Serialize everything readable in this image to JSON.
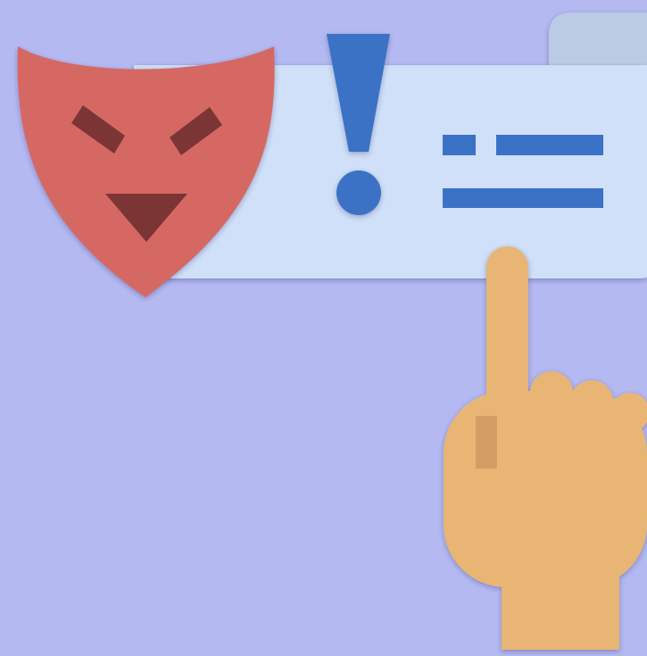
{
  "colors": {
    "background": "#B4B9F1",
    "panel": "#CFE0F8",
    "panel_tab": "#BACBE3",
    "alert_accent": "#3A72C6",
    "mask": "#D66764",
    "mask_features": "#7B3534",
    "hand": "#E8B575",
    "hand_shade": "#D39E63"
  },
  "icons": {
    "mask": "devil-mask-icon",
    "alert": "exclamation-icon",
    "hand": "pointing-hand-icon"
  },
  "text_lines": [
    {
      "segments": 2
    },
    {
      "segments": 1
    }
  ]
}
